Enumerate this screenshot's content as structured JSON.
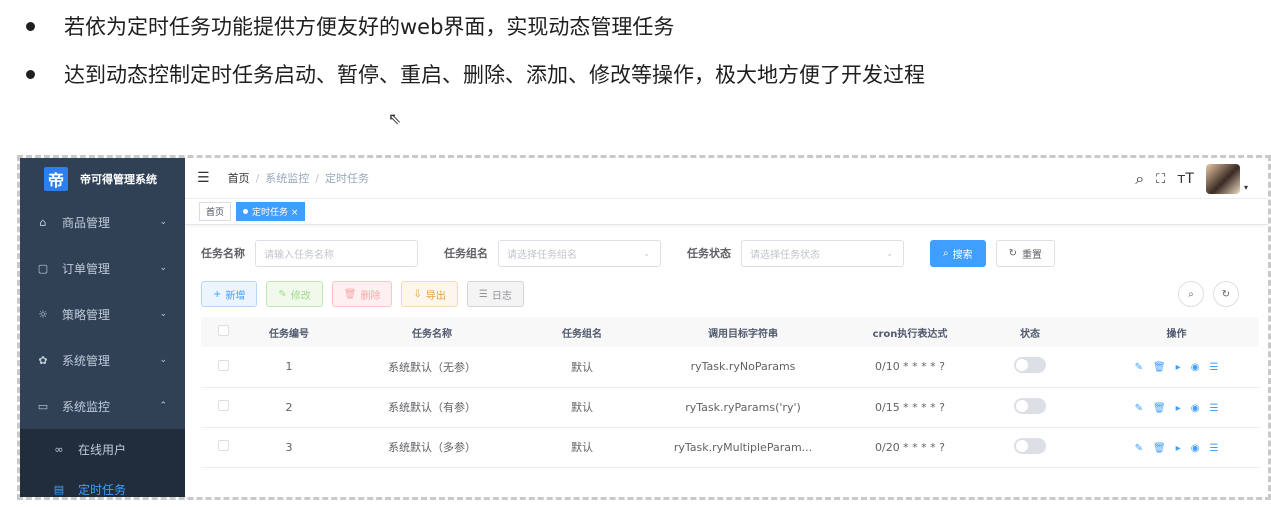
{
  "slide": {
    "bullets": [
      "若依为定时任务功能提供方便友好的web界面，实现动态管理任务",
      "达到动态控制定时任务启动、暂停、重启、删除、添加、修改等操作，极大地方便了开发过程"
    ]
  },
  "sidebar": {
    "logo_char": "帝",
    "app_name": "帝可得管理系统",
    "items": [
      {
        "icon": "shop-icon",
        "glyph": "⌂",
        "label": "商品管理",
        "chevron": "⌄"
      },
      {
        "icon": "order-icon",
        "glyph": "▢",
        "label": "订单管理",
        "chevron": "⌄"
      },
      {
        "icon": "bulb-icon",
        "glyph": "☼",
        "label": "策略管理",
        "chevron": "⌄"
      },
      {
        "icon": "gear-icon",
        "glyph": "✿",
        "label": "系统管理",
        "chevron": "⌄"
      },
      {
        "icon": "monitor-icon",
        "glyph": "▭",
        "label": "系统监控",
        "chevron": "⌃"
      }
    ],
    "subitems": [
      {
        "icon": "online-user-icon",
        "glyph": "∞",
        "label": "在线用户"
      },
      {
        "icon": "job-icon",
        "glyph": "▤",
        "label": "定时任务"
      }
    ]
  },
  "navbar": {
    "breadcrumb": [
      "首页",
      "系统监控",
      "定时任务"
    ],
    "separator": "/"
  },
  "tags": [
    {
      "label": "首页"
    },
    {
      "label": "定时任务 ×"
    }
  ],
  "search": {
    "job_name_label": "任务名称",
    "job_name_placeholder": "请输入任务名称",
    "job_group_label": "任务组名",
    "job_group_placeholder": "请选择任务组名",
    "job_status_label": "任务状态",
    "job_status_placeholder": "请选择任务状态",
    "search_button": "搜索",
    "reset_button": "重置"
  },
  "toolbar": {
    "add": "新增",
    "edit": "修改",
    "delete": "删除",
    "export": "导出",
    "log": "日志"
  },
  "table": {
    "headers": [
      "任务编号",
      "任务名称",
      "任务组名",
      "调用目标字符串",
      "cron执行表达式",
      "状态",
      "操作"
    ],
    "rows": [
      {
        "id": "1",
        "name": "系统默认（无参）",
        "group": "默认",
        "target": "ryTask.ryNoParams",
        "cron": "0/10 * * * * ?",
        "enabled": false
      },
      {
        "id": "2",
        "name": "系统默认（有参）",
        "group": "默认",
        "target": "ryTask.ryParams('ry')",
        "cron": "0/15 * * * * ?",
        "enabled": false
      },
      {
        "id": "3",
        "name": "系统默认（多参）",
        "group": "默认",
        "target": "ryTask.ryMultipleParam...",
        "cron": "0/20 * * * * ?",
        "enabled": false
      }
    ]
  },
  "colors": {
    "sidebar_bg": "#304156",
    "primary": "#409eff"
  }
}
